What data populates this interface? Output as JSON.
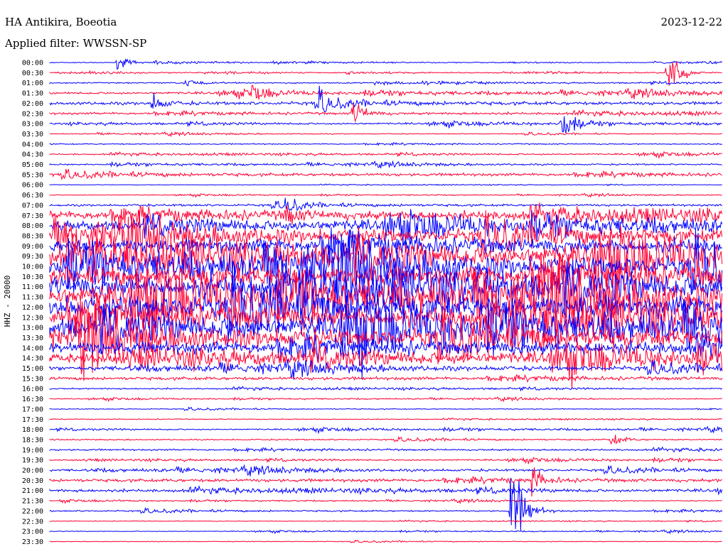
{
  "header": {
    "station": "HA Antikira, Boeotia",
    "date": "2023-12-22",
    "filter": "Applied filter: WWSSN-SP",
    "channel": "HHZ - 20000"
  },
  "colors": {
    "trace_a": "#0000ff",
    "trace_b": "#ff0033",
    "background": "#ffffff",
    "text": "#000000"
  },
  "chart_data": {
    "type": "line",
    "title": "HA Antikira, Boeotia",
    "ylabel": "HHZ - 20000",
    "tick_labels": [
      "00:00",
      "00:30",
      "01:00",
      "01:30",
      "02:00",
      "02:30",
      "03:00",
      "03:30",
      "04:00",
      "04:30",
      "05:00",
      "05:30",
      "06:00",
      "06:30",
      "07:00",
      "07:30",
      "08:00",
      "08:30",
      "09:00",
      "09:30",
      "10:00",
      "10:30",
      "11:00",
      "11:30",
      "12:00",
      "12:30",
      "13:00",
      "13:30",
      "14:00",
      "14:30",
      "15:00",
      "15:30",
      "16:00",
      "16:30",
      "17:00",
      "17:30",
      "18:00",
      "18:30",
      "19:00",
      "19:30",
      "20:00",
      "20:30",
      "21:00",
      "21:30",
      "22:00",
      "22:30",
      "23:00",
      "23:30"
    ],
    "row_minutes": 30,
    "noise_level": [
      0.6,
      0.6,
      0.9,
      1.6,
      2.2,
      1.6,
      1.2,
      0.6,
      0.8,
      1.0,
      1.0,
      2.0,
      0.4,
      0.5,
      1.5,
      6,
      7,
      9,
      10,
      13,
      13,
      14,
      15,
      15,
      16,
      15,
      14,
      12,
      9,
      8,
      3,
      2.2,
      1.0,
      0.6,
      0.6,
      0.6,
      0.9,
      0.9,
      1.2,
      1.0,
      1.6,
      2.2,
      2.0,
      0.6,
      1.0,
      0.5,
      0.5,
      0.5
    ],
    "events": [
      {
        "row": 0,
        "minute": 3.0,
        "amplitude": 8
      },
      {
        "row": 1,
        "minute": 27.5,
        "amplitude": 40
      },
      {
        "row": 2,
        "minute": 6.0,
        "amplitude": 6
      },
      {
        "row": 3,
        "minute": 9.0,
        "amplitude": 12
      },
      {
        "row": 4,
        "minute": 4.5,
        "amplitude": 12
      },
      {
        "row": 4,
        "minute": 12.0,
        "amplitude": 12
      },
      {
        "row": 5,
        "minute": 13.5,
        "amplitude": 16
      },
      {
        "row": 6,
        "minute": 22.8,
        "amplitude": 24
      },
      {
        "row": 14,
        "minute": 10.5,
        "amplitude": 10
      },
      {
        "row": 15,
        "minute": 10.5,
        "amplitude": 12
      },
      {
        "row": 44,
        "minute": 20.5,
        "amplitude": 70
      },
      {
        "row": 41,
        "minute": 21.5,
        "amplitude": 14
      },
      {
        "row": 37,
        "minute": 25.0,
        "amplitude": 8
      }
    ]
  }
}
